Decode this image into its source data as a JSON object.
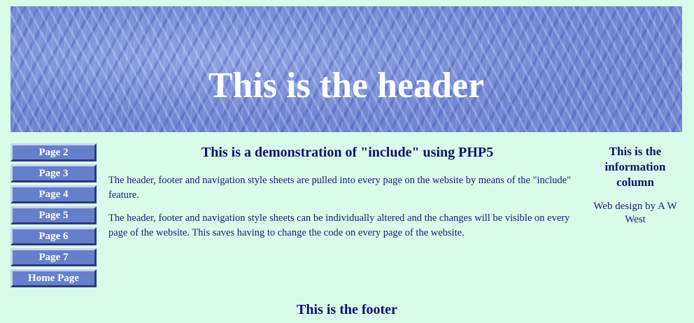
{
  "header": {
    "title": "This is the header"
  },
  "nav": {
    "items": [
      {
        "label": "Page 2"
      },
      {
        "label": "Page 3"
      },
      {
        "label": "Page 4"
      },
      {
        "label": "Page 5"
      },
      {
        "label": "Page 6"
      },
      {
        "label": "Page 7"
      },
      {
        "label": "Home Page"
      }
    ]
  },
  "main": {
    "title": "This is a demonstration of \"include\" using PHP5",
    "paragraphs": [
      "The header, footer and navigation style sheets are pulled into every page on the website by means of the \"include\" feature.",
      "The header, footer and navigation style sheets can be individually altered and the changes will be visible on every page of the website. This saves having to change the code on every page of the website."
    ]
  },
  "info": {
    "title": "This is the information column",
    "credit": "Web design by A W West"
  },
  "footer": {
    "text": "This is the footer"
  },
  "colors": {
    "page_background": "#d9fce9",
    "header_background": "#6f86d3",
    "nav_button": "#6480cc",
    "text": "#10106e"
  }
}
